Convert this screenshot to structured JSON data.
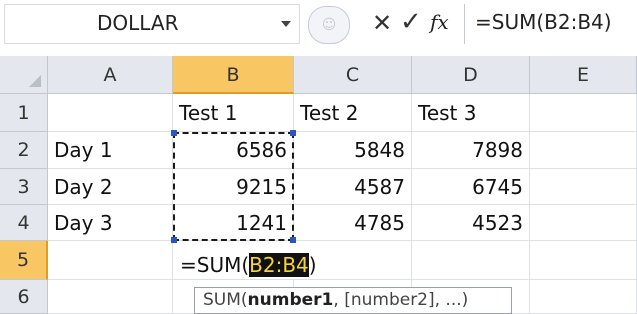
{
  "name_box": {
    "value": "DOLLAR"
  },
  "formula_bar": {
    "fx_label": "fx",
    "formula": "=SUM(B2:B4)"
  },
  "columns": [
    "A",
    "B",
    "C",
    "D",
    "E"
  ],
  "rows": [
    "1",
    "2",
    "3",
    "4",
    "5",
    "6"
  ],
  "cells": {
    "B1": "Test 1",
    "C1": "Test 2",
    "D1": "Test 3",
    "A2": "Day 1",
    "B2": "6586",
    "C2": "5848",
    "D2": "7898",
    "A3": "Day 2",
    "B3": "9215",
    "C3": "4587",
    "D3": "6745",
    "A4": "Day 3",
    "B4": "1241",
    "C4": "4785",
    "D4": "4523"
  },
  "edit": {
    "prefix": "=SUM(",
    "range": "B2:B4",
    "suffix": ")"
  },
  "tooltip": {
    "func": "SUM(",
    "arg1": "number1",
    "rest": ", [number2], ...)"
  },
  "colors": {
    "selected_header": "#f8c763",
    "header": "#e4e8ee",
    "range_highlight": "#f5d53a"
  }
}
